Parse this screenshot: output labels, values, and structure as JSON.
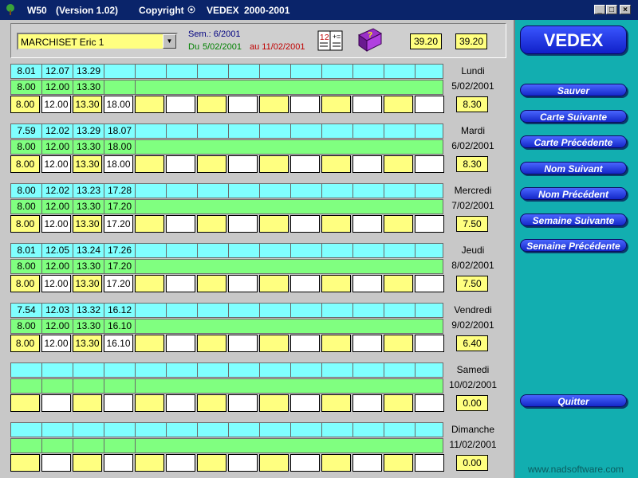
{
  "window": {
    "title_app": "W50",
    "title_version": "(Version 1.02)",
    "title_copyright": "Copyright",
    "title_brand": "VEDEX",
    "title_years": "2000-2001",
    "minimize_glyph": "_",
    "maximize_glyph": "□",
    "close_glyph": "×"
  },
  "header": {
    "employee": "MARCHISET Eric 1",
    "week_label": "Sem.: 6/2001",
    "from_label": "Du",
    "from_date": "5/02/2001",
    "to_label": "au 11/02/2001",
    "total_a": "39.20",
    "total_b": "39.20"
  },
  "days": [
    {
      "name": "Lundi",
      "date": "5/02/2001",
      "total": "8.30",
      "cyan": [
        "8.01",
        "12.07",
        "13.29",
        ""
      ],
      "green": [
        "8.00",
        "12.00",
        "13.30",
        ""
      ],
      "input": [
        "8.00",
        "12.00",
        "13.30",
        "18.00"
      ]
    },
    {
      "name": "Mardi",
      "date": "6/02/2001",
      "total": "8.30",
      "cyan": [
        "7.59",
        "12.02",
        "13.29",
        "18.07"
      ],
      "green": [
        "8.00",
        "12.00",
        "13.30",
        "18.00"
      ],
      "input": [
        "8.00",
        "12.00",
        "13.30",
        "18.00"
      ]
    },
    {
      "name": "Mercredi",
      "date": "7/02/2001",
      "total": "7.50",
      "cyan": [
        "8.00",
        "12.02",
        "13.23",
        "17.28"
      ],
      "green": [
        "8.00",
        "12.00",
        "13.30",
        "17.20"
      ],
      "input": [
        "8.00",
        "12.00",
        "13.30",
        "17.20"
      ]
    },
    {
      "name": "Jeudi",
      "date": "8/02/2001",
      "total": "7.50",
      "cyan": [
        "8.01",
        "12.05",
        "13.24",
        "17.26"
      ],
      "green": [
        "8.00",
        "12.00",
        "13.30",
        "17.20"
      ],
      "input": [
        "8.00",
        "12.00",
        "13.30",
        "17.20"
      ]
    },
    {
      "name": "Vendredi",
      "date": "9/02/2001",
      "total": "6.40",
      "cyan": [
        "7.54",
        "12.03",
        "13.32",
        "16.12"
      ],
      "green": [
        "8.00",
        "12.00",
        "13.30",
        "16.10"
      ],
      "input": [
        "8.00",
        "12.00",
        "13.30",
        "16.10"
      ]
    },
    {
      "name": "Samedi",
      "date": "10/02/2001",
      "total": "0.00",
      "cyan": [
        "",
        "",
        "",
        ""
      ],
      "green": [
        "",
        "",
        "",
        ""
      ],
      "input": [
        "",
        "",
        "",
        ""
      ]
    },
    {
      "name": "Dimanche",
      "date": "11/02/2001",
      "total": "0.00",
      "cyan": [
        "",
        "",
        "",
        ""
      ],
      "green": [
        "",
        "",
        "",
        ""
      ],
      "input": [
        "",
        "",
        "",
        ""
      ]
    }
  ],
  "side": {
    "brand": "VEDEX",
    "buttons": [
      "Sauver",
      "Carte Suivante",
      "Carte Précédente",
      "Nom Suivant",
      "Nom Précédent",
      "Semaine Suivante",
      "Semaine Précédente"
    ],
    "quit": "Quitter",
    "website": "www.nadsoftware.com"
  },
  "icons": {
    "app": "tree-icon",
    "calculator": "calculator-icon",
    "help": "help-book-icon"
  },
  "colors": {
    "titlebar": "#0a246a",
    "panel": "#12aeb0",
    "cyan_row": "#80ffff",
    "green_row": "#80ff80",
    "input_yellow": "#ffff80",
    "button_blue": "#1428c8",
    "date_green": "#008000",
    "date_red": "#c00000",
    "week_blue": "#000080"
  }
}
